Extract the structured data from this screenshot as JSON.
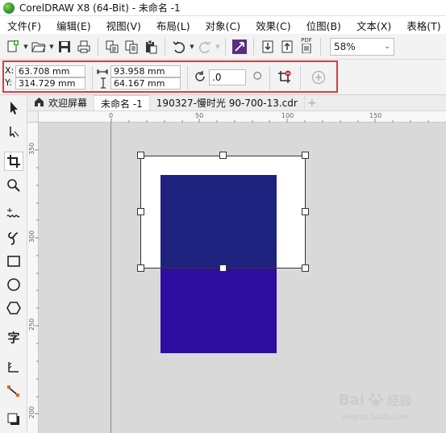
{
  "window": {
    "title": "CorelDRAW X8 (64-Bit) - 未命名 -1"
  },
  "menu": [
    {
      "label": "文件(F)"
    },
    {
      "label": "编辑(E)"
    },
    {
      "label": "视图(V)"
    },
    {
      "label": "布局(L)"
    },
    {
      "label": "对象(C)"
    },
    {
      "label": "效果(C)"
    },
    {
      "label": "位图(B)"
    },
    {
      "label": "文本(X)"
    },
    {
      "label": "表格(T)"
    }
  ],
  "toolbar": {
    "icons": [
      "new-icon",
      "open-icon",
      "save-icon",
      "print-icon",
      "cut-icon",
      "copy-icon",
      "paste-icon",
      "undo-icon",
      "redo-icon",
      "corel-connect-icon",
      "import-icon",
      "export-icon",
      "publish-pdf-icon"
    ],
    "pdf_label": "PDF",
    "zoom_value": "58%"
  },
  "property_bar": {
    "x_label": "X:",
    "x_value": "63.708 mm",
    "y_label": "Y:",
    "y_value": "314.729 mm",
    "width_value": "93.958 mm",
    "height_value": "64.167 mm",
    "rotation_value": ".0"
  },
  "tabs": [
    {
      "label": "欢迎屏幕",
      "icon": "home-icon",
      "active": false
    },
    {
      "label": "未命名 -1",
      "active": true
    },
    {
      "label": "190327-慢时光 90-700-13.cdr",
      "active": false
    }
  ],
  "ruler": {
    "horizontal_ticks": [
      "0",
      "50",
      "100",
      "150"
    ],
    "vertical_ticks": [
      "350",
      "300",
      "250",
      "200"
    ]
  },
  "colors": {
    "highlight": "#e23a3a",
    "rect_top": "#1f2380",
    "rect_bottom": "#2d0ea0",
    "canvas": "#d9d9d9"
  },
  "watermark": {
    "text": "Bai",
    "suffix": "经验",
    "sub": "jingyan.baidu.com"
  }
}
